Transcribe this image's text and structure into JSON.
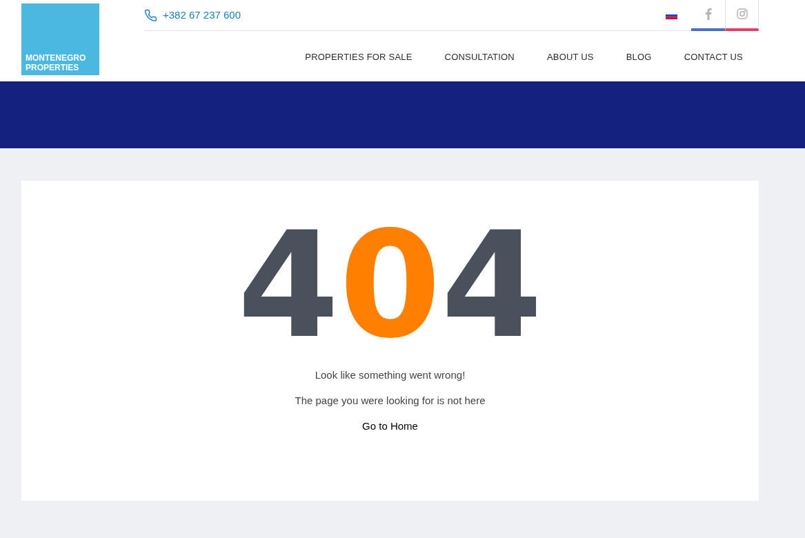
{
  "logo": {
    "lines": [
      "MONTENEGRO",
      "PROPERTIES"
    ]
  },
  "topbar": {
    "phone": "+382 67 237 600"
  },
  "nav": {
    "items": [
      "PROPERTIES FOR SALE",
      "CONSULTATION",
      "ABOUT US",
      "BLOG",
      "CONTACT US"
    ]
  },
  "error": {
    "code": [
      {
        "text": "4",
        "color": "#4a505c"
      },
      {
        "text": "0",
        "color": "#ff7f00"
      },
      {
        "text": "4",
        "color": "#4a505c"
      }
    ],
    "messages": [
      "Look like something went wrong!",
      "The page you were looking for is not here"
    ],
    "home_link": "Go to Home"
  }
}
